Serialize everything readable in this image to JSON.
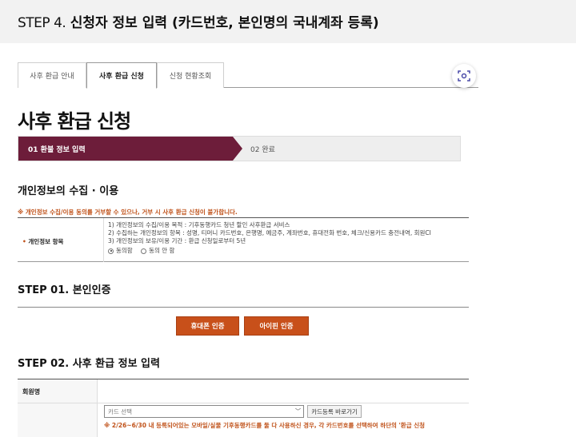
{
  "header": {
    "step_prefix": "STEP 4.",
    "step_title": "신청자 정보 입력 (카드번호, 본인명의 국내계좌 등록)"
  },
  "tabs": [
    {
      "label": "사후 환급 안내",
      "active": false
    },
    {
      "label": "사후 환급 신청",
      "active": true
    },
    {
      "label": "신청 현황조회",
      "active": false
    }
  ],
  "page_title": "사후 환급 신청",
  "progress": {
    "current": "01 환불 정보 입력",
    "next": "02 완료"
  },
  "privacy": {
    "heading": "개인정보의 수집 · 이용",
    "warning": "※ 개인정보 수집/이용 동의를 거부할 수 있으나, 거부 시 사후 환급 신청이 불가합니다.",
    "label": "개인정보 항목",
    "lines": [
      "1) 개인정보의 수집/이용 목적 : 기후동행카드 청년 할인 사후환급 서비스",
      "2) 수집하는 개인정보의 항목 : 성명, 티머니 카드번호, 은행명, 예금주, 계좌번호, 휴대전화 번호, 체크/신용카드 충전내역, 회원CI",
      "3) 개인정보의 보유/이용 기간 : 환급 신청일로부터 5년"
    ],
    "agree": "동의함",
    "disagree": "동의 안 함"
  },
  "step1": {
    "heading": "STEP 01. 본인인증",
    "phone_btn": "휴대폰 인증",
    "ipin_btn": "아이핀 인증"
  },
  "step2": {
    "heading": "STEP 02. 사후 환급 정보 입력",
    "member_label": "회원명",
    "card_select": "카드 선택",
    "card_register_btn": "카드등록 바로가기",
    "note": "※ 2/26~6/30 내 등록되어있는 모바일/실물 기후동행카드를 둘 다 사용하신 경우, 각 카드번호를 선택하여 하단의 '환급 신청"
  },
  "colors": {
    "accent": "#6d1d3a",
    "button": "#c8501a",
    "warning": "#c0521a"
  }
}
